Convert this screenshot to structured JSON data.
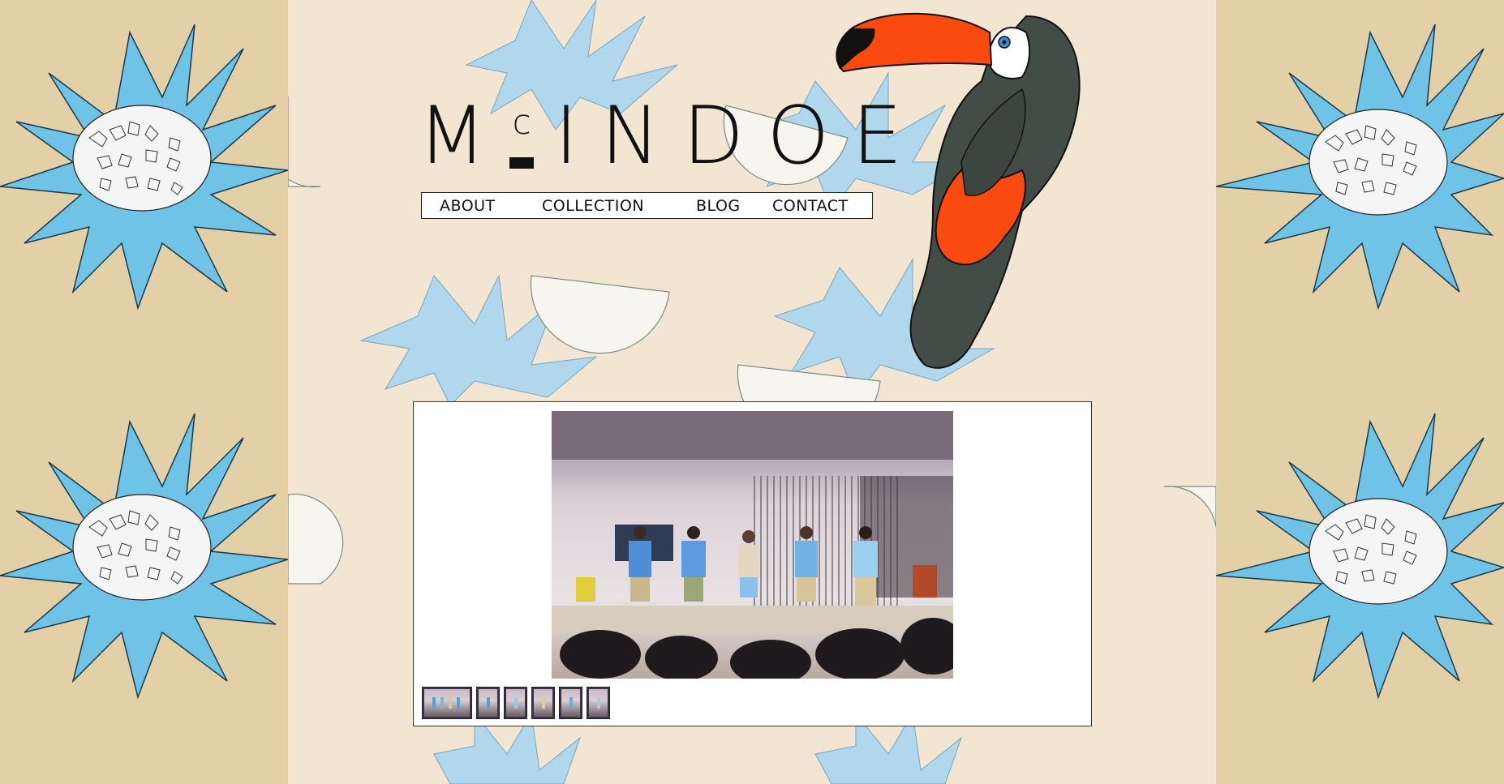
{
  "brand": {
    "logo_text_m": "M",
    "logo_text_c": "c",
    "logo_text_rest": "INDOE"
  },
  "nav": {
    "items": [
      {
        "label": "ABOUT"
      },
      {
        "label": "COLLECTION"
      },
      {
        "label": "BLOG"
      },
      {
        "label": "CONTACT"
      }
    ]
  },
  "gallery": {
    "thumbnail_count": 6,
    "active_thumbnail": 1
  },
  "colors": {
    "side_bg": "#e4d0a6",
    "center_bg": "#f2e6d2",
    "leaf_blue": "#6ec3e6",
    "toucan_orange": "#fb4a0f",
    "toucan_body": "#434d48"
  },
  "icons": [
    "toucan-illustration",
    "pineapple-pattern",
    "watermelon-pattern"
  ]
}
